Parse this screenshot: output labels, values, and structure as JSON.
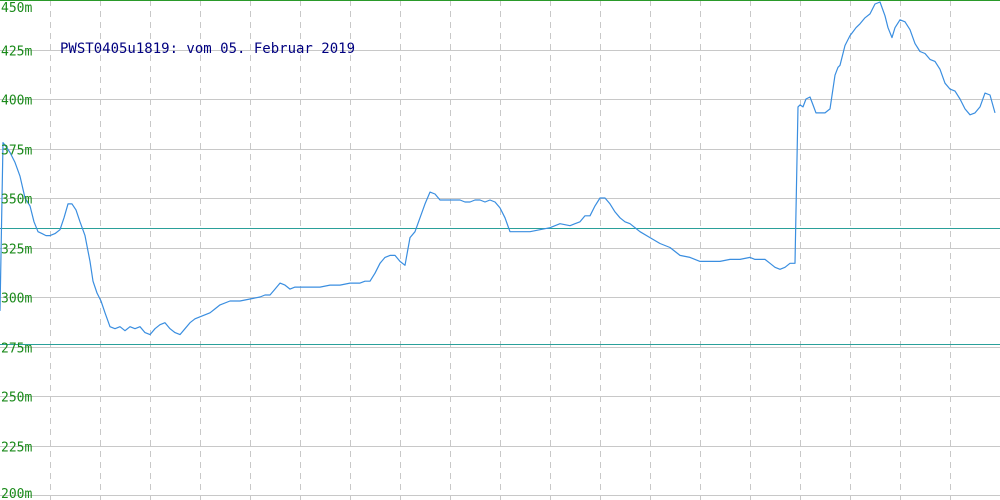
{
  "chart_data": {
    "type": "line",
    "title": "PWST0405u1819: vom 05. Februar 2019",
    "xlabel": "",
    "ylabel": "",
    "ylim": [
      200,
      450
    ],
    "y_ticks": [
      450,
      425,
      400,
      375,
      350,
      325,
      300,
      275,
      250,
      225,
      200
    ],
    "y_tick_labels": [
      "450m",
      "425m",
      "400m",
      "375m",
      "350m",
      "325m",
      "300m",
      "275m",
      "250m",
      "225m",
      "200m"
    ],
    "grid": true,
    "x_range": [
      0,
      100
    ],
    "reference_lines": [
      {
        "value": 450,
        "color": "#2a9a2a"
      },
      {
        "value": 335,
        "color": "#2aa09a"
      },
      {
        "value": 276.5,
        "color": "#2aa09a"
      }
    ],
    "series": [
      {
        "color": "#3a8ee0",
        "x": [
          0,
          0.3,
          0.6,
          1.0,
          1.5,
          2.0,
          2.5,
          3.0,
          3.4,
          3.8,
          4.2,
          4.6,
          5.0,
          5.5,
          6.0,
          6.4,
          6.8,
          7.2,
          7.6,
          8.0,
          8.5,
          9.0,
          9.3,
          9.7,
          10.1,
          10.5,
          11.0,
          11.5,
          12.0,
          12.5,
          13.0,
          13.5,
          14.0,
          14.5,
          15.0,
          15.5,
          16.0,
          16.5,
          17.0,
          17.5,
          18.0,
          18.5,
          19.0,
          19.5,
          20.0,
          20.5,
          21.0,
          21.5,
          22.0,
          23.0,
          24.0,
          25.0,
          26.0,
          26.5,
          27.0,
          27.5,
          28.0,
          28.5,
          29.0,
          29.5,
          30.0,
          31.0,
          32.0,
          33.0,
          34.0,
          35.0,
          35.5,
          36.0,
          36.5,
          37.0,
          37.5,
          38.0,
          38.5,
          39.0,
          39.5,
          40.0,
          40.5,
          41.0,
          41.5,
          42.0,
          42.5,
          43.0,
          43.5,
          44.0,
          44.5,
          45.0,
          45.5,
          46.0,
          46.5,
          47.0,
          47.5,
          48.0,
          48.5,
          49.0,
          49.5,
          50.0,
          50.5,
          51.0,
          51.5,
          52.0,
          53.0,
          54.0,
          55.0,
          56.0,
          57.0,
          57.5,
          58.0,
          58.5,
          59.0,
          59.5,
          60.0,
          60.5,
          61.0,
          61.5,
          62.0,
          62.5,
          63.0,
          64.0,
          65.0,
          66.0,
          67.0,
          68.0,
          69.0,
          70.0,
          71.0,
          72.0,
          73.0,
          74.0,
          75.0,
          75.5,
          76.0,
          76.5,
          77.0,
          77.5,
          78.0,
          78.5,
          79.0,
          79.5,
          79.8,
          80.0,
          80.3,
          80.6,
          81.0,
          81.3,
          81.6,
          82.0,
          82.5,
          83.0,
          83.5,
          83.8,
          84.0,
          84.5,
          85.0,
          85.3,
          85.6,
          86.0,
          86.5,
          87.0,
          87.5,
          88.0,
          88.5,
          88.8,
          89.2,
          89.5,
          90.0,
          90.5,
          91.0,
          91.5,
          92.0,
          92.5,
          93.0,
          93.5,
          94.0,
          94.5,
          95.0,
          95.5,
          96.0,
          96.5,
          97.0,
          97.5,
          98.0,
          98.5,
          99.0,
          99.5
        ],
        "values": [
          293,
          378,
          376,
          373,
          368,
          361,
          350,
          346,
          338,
          333,
          332,
          331,
          331,
          332,
          334,
          340,
          347,
          347,
          344,
          338,
          331,
          318,
          308,
          302,
          298,
          292,
          285,
          284,
          285,
          283,
          285,
          284,
          285,
          282,
          281,
          284,
          286,
          287,
          284,
          282,
          281,
          284,
          287,
          289,
          290,
          291,
          292,
          294,
          296,
          298,
          298,
          299,
          300,
          301,
          301,
          304,
          307,
          306,
          304,
          305,
          305,
          305,
          305,
          306,
          306,
          307,
          307,
          307,
          308,
          308,
          312,
          317,
          320,
          321,
          321,
          318,
          316,
          330,
          333,
          340,
          347,
          353,
          352,
          349,
          349,
          349,
          349,
          349,
          348,
          348,
          349,
          349,
          348,
          349,
          348,
          345,
          340,
          333,
          333,
          333,
          333,
          334,
          335,
          337,
          336,
          337,
          338,
          341,
          341,
          346,
          350,
          350,
          347,
          343,
          340,
          338,
          337,
          333,
          330,
          327,
          325,
          321,
          320,
          318,
          318,
          318,
          319,
          319,
          320,
          319,
          319,
          319,
          317,
          315,
          314,
          315,
          317,
          317,
          396,
          397,
          396,
          400,
          401,
          397,
          393,
          393,
          393,
          395,
          412,
          416,
          417,
          427,
          432,
          434,
          436,
          438,
          441,
          443,
          448,
          449,
          442,
          436,
          431,
          436,
          440,
          439,
          435,
          428,
          424,
          423,
          420,
          419,
          415,
          408,
          405,
          404,
          400,
          395,
          392,
          393,
          396,
          403,
          402,
          393
        ]
      }
    ]
  }
}
